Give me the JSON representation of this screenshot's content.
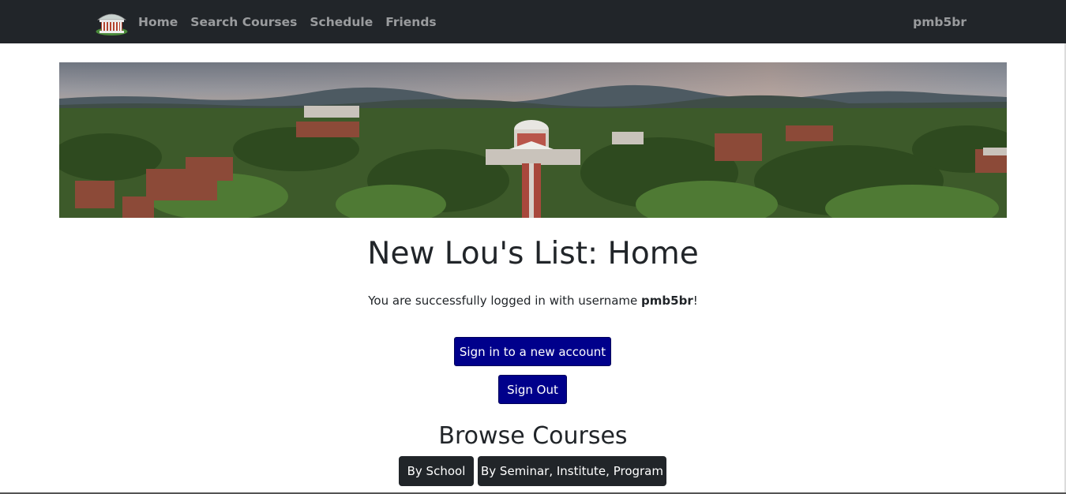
{
  "navbar": {
    "links": [
      {
        "label": "Home"
      },
      {
        "label": "Search Courses"
      },
      {
        "label": "Schedule"
      },
      {
        "label": "Friends"
      }
    ],
    "username": "pmb5br"
  },
  "main": {
    "title": "New Lou's List: Home",
    "login_message_prefix": "You are successfully logged in with username ",
    "login_username": "pmb5br",
    "login_message_suffix": "!",
    "sign_in_button": "Sign in to a new account",
    "sign_out_button": "Sign Out",
    "browse_title": "Browse Courses",
    "browse_buttons": [
      {
        "label": "By School"
      },
      {
        "label": "By Seminar, Institute, Program"
      }
    ]
  },
  "colors": {
    "navbar_bg": "#212529",
    "primary_button": "#00008b",
    "dark_button": "#212529"
  },
  "icons": {
    "logo": "rotunda-logo-icon"
  }
}
